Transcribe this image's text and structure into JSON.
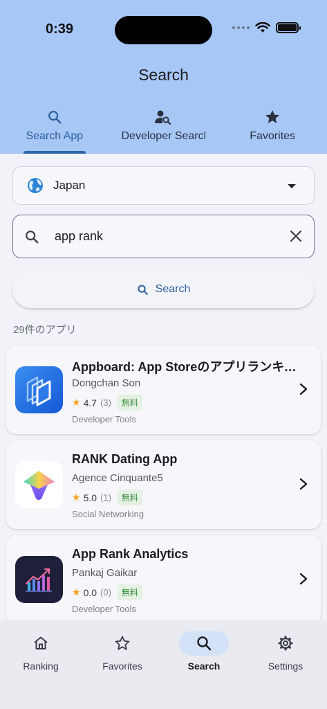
{
  "status": {
    "time": "0:39"
  },
  "header": {
    "title": "Search"
  },
  "tabs": [
    {
      "label": "Search App",
      "icon": "search-icon",
      "active": true
    },
    {
      "label": "Developer Search",
      "icon": "person-search-icon",
      "active": false
    },
    {
      "label": "Favorites",
      "icon": "star-icon",
      "active": false
    }
  ],
  "country": {
    "label": "Japan",
    "icon": "globe-icon"
  },
  "search": {
    "value": "app rank",
    "button_label": "Search"
  },
  "results": {
    "count_label": "29件のアプリ",
    "items": [
      {
        "name": "Appboard: App Storeのアプリランキング",
        "developer": "Dongchan Son",
        "rating": "4.7",
        "rating_count": "(3)",
        "price": "無料",
        "category": "Developer Tools"
      },
      {
        "name": "RANK Dating App",
        "developer": "Agence Cinquante5",
        "rating": "5.0",
        "rating_count": "(1)",
        "price": "無料",
        "category": "Social Networking"
      },
      {
        "name": "App Rank Analytics",
        "developer": "Pankaj Gaikar",
        "rating": "0.0",
        "rating_count": "(0)",
        "price": "無料",
        "category": "Developer Tools"
      }
    ]
  },
  "bottom_nav": [
    {
      "label": "Ranking",
      "icon": "home-icon"
    },
    {
      "label": "Favorites",
      "icon": "star-outline-icon"
    },
    {
      "label": "Search",
      "icon": "search-icon",
      "active": true
    },
    {
      "label": "Settings",
      "icon": "gear-icon"
    }
  ],
  "colors": {
    "header_bg": "#a7c8f7",
    "accent": "#2c5e9c",
    "free_badge_text": "#3c8f3e",
    "star": "#f3a21b"
  }
}
